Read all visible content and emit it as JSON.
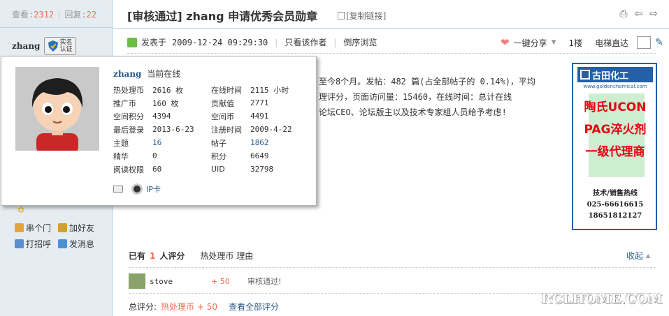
{
  "stats": {
    "views_label": "查看:",
    "views": "2312",
    "replies_label": "回复:",
    "replies": "22",
    "sep": "|"
  },
  "author": {
    "name": "zhang",
    "badge_text": "实名认证"
  },
  "actions": {
    "chuanmen": "串个门",
    "add_friend": "加好友",
    "greet": "打招呼",
    "message": "发消息"
  },
  "thread": {
    "tag": "[审核通过]",
    "title": "zhang 申请优秀会员勋章",
    "copy_link": "[复制链接]"
  },
  "post_meta": {
    "posted_label": "发表于",
    "time": "2009-12-24 09:29:30",
    "only_author": "只看该作者",
    "reverse": "倒序浏览",
    "pipe": "|"
  },
  "post_tools": {
    "share": "一键分享",
    "floor": "1楼",
    "elevator": "电梯直达"
  },
  "body_lines": [
    "至今8个月。发帖：482 篇(占全部帖子的 0.14%)，平均",
    "理评分，页面访问量：15460，在线时间：总计在线",
    "论坛CEO、论坛版主以及技术专家组人员给予考虑!"
  ],
  "popup": {
    "name": "zhang",
    "status": "当前在线",
    "rows": [
      {
        "l1": "热处理币",
        "v1": "2616 枚",
        "l2": "在线时间",
        "v2": "2115 小时"
      },
      {
        "l1": "推广币",
        "v1": "160 枚",
        "l2": "贡献值",
        "v2": "2771"
      },
      {
        "l1": "空间积分",
        "v1": "4394",
        "l2": "空间币",
        "v2": "4491"
      },
      {
        "l1": "最后登录",
        "v1": "2013-6-23",
        "l2": "注册时间",
        "v2": "2009-4-22"
      },
      {
        "l1": "主题",
        "v1": "16",
        "l2": "帖子",
        "v2": "1862"
      },
      {
        "l1": "精华",
        "v1": "0",
        "l2": "积分",
        "v2": "6649"
      },
      {
        "l1": "阅读权限",
        "v1": "60",
        "l2": "UID",
        "v2": "32798"
      }
    ],
    "ip_card": "IP卡"
  },
  "ad": {
    "logo": "古田化工",
    "url": "www.goldenchemical.com",
    "line1": "陶氏UCON",
    "line2": "PAG淬火剂",
    "line3": "一级代理商",
    "hotline_label": "技术/销售热线",
    "phone1": "025-66616615",
    "phone2": "18651812127"
  },
  "rating": {
    "prefix": "已有",
    "count": "1",
    "suffix": "人评分",
    "col2": "热处理币 理由",
    "collapse": "收起",
    "rows": [
      {
        "user": "stove",
        "score": "+ 50",
        "reason": "审核通过!"
      }
    ],
    "total_label": "总评分:",
    "total_value": "热处理币 + 50",
    "view_all": "查看全部评分"
  },
  "watermark": "RCLHOME.COM",
  "colors": {
    "accent": "#f26c4f",
    "link": "#2c5a8c",
    "sidebar_bg": "#e5edf2",
    "ad_border": "#2460a8",
    "ad_red": "#e60012"
  }
}
